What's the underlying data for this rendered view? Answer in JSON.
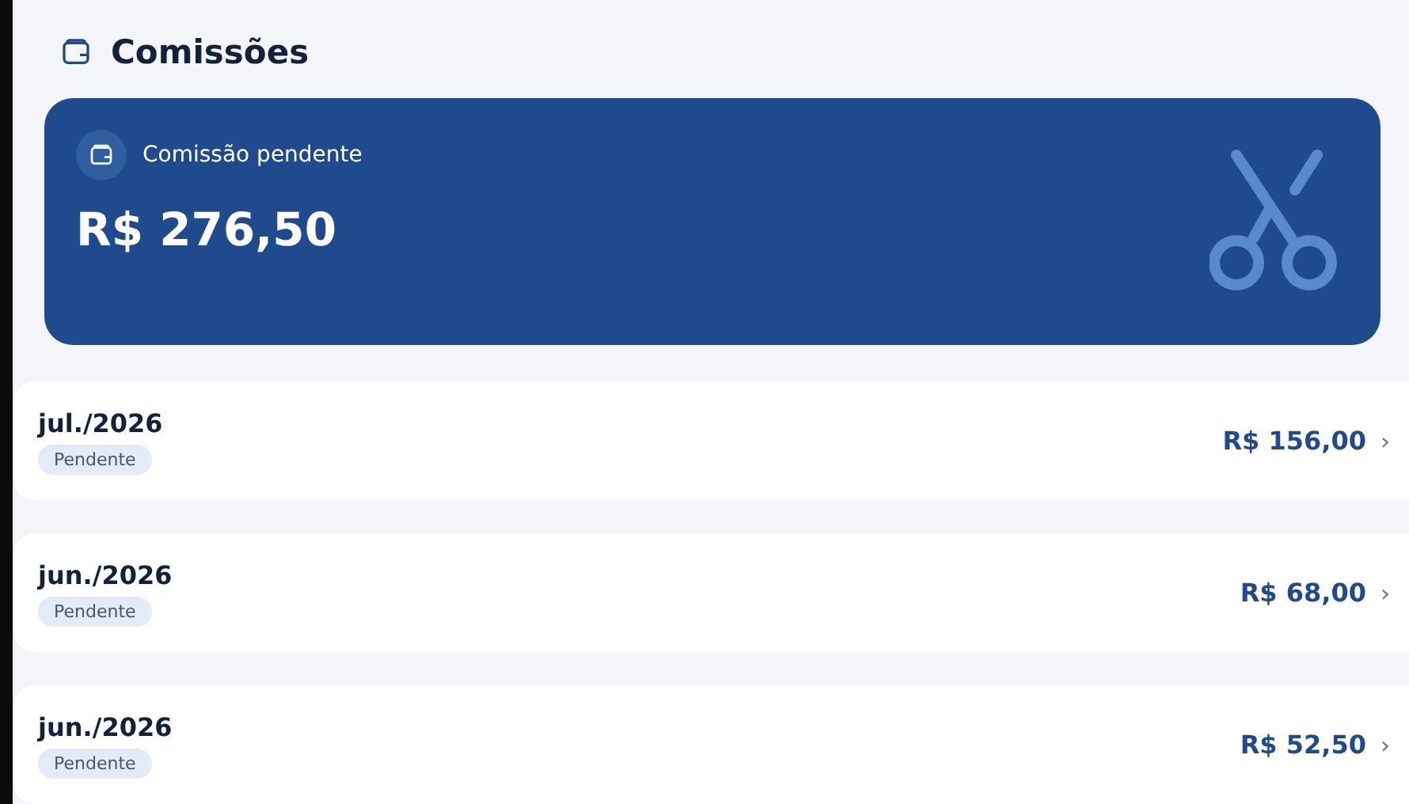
{
  "header": {
    "title": "Comissões"
  },
  "summary": {
    "label": "Comissão pendente",
    "amount": "R$ 276,50"
  },
  "months": [
    {
      "period": "jul./2026",
      "status": "Pendente",
      "amount": "R$ 156,00",
      "chevron": "›"
    },
    {
      "period": "jun./2026",
      "status": "Pendente",
      "amount": "R$ 68,00",
      "chevron": "›"
    },
    {
      "period": "jun./2026",
      "status": "Pendente",
      "amount": "R$ 52,50",
      "chevron": "›"
    }
  ]
}
